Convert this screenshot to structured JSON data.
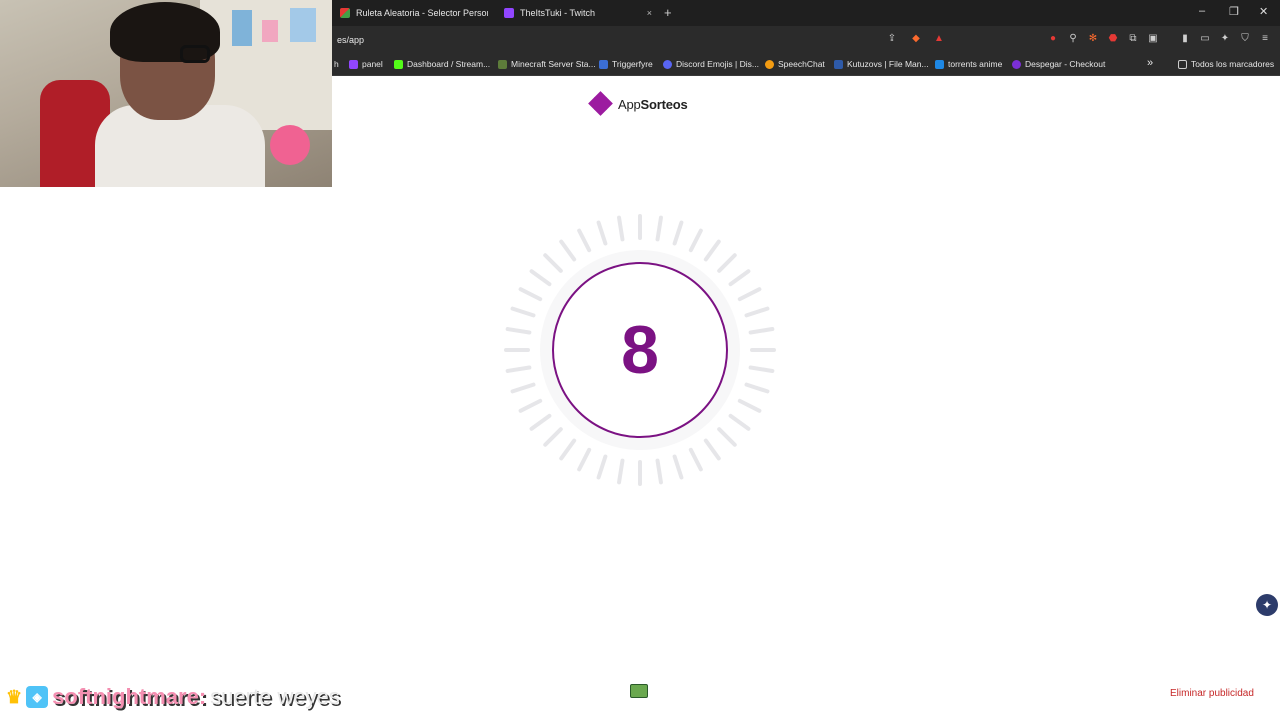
{
  "tabs": [
    {
      "title": "Ruleta Aleatoria - Selector Personaliz",
      "active": true
    },
    {
      "title": "TheItsTuki - Twitch",
      "close": "×"
    }
  ],
  "new_tab": "+",
  "window_controls": {
    "minimize": "–",
    "restore": "❐",
    "close": "✕"
  },
  "address_bar": {
    "url": "es/app"
  },
  "bookmarks": [
    {
      "label": "h"
    },
    {
      "label": "panel"
    },
    {
      "label": "Dashboard / Stream..."
    },
    {
      "label": "Minecraft Server Sta..."
    },
    {
      "label": "Triggerfyre"
    },
    {
      "label": "Discord Emojis | Dis..."
    },
    {
      "label": "SpeechChat"
    },
    {
      "label": "Kutuzovs | File Man..."
    },
    {
      "label": "torrents anime"
    },
    {
      "label": "Despegar - Checkout"
    },
    {
      "label": "»"
    },
    {
      "label": "Todos los marcadores"
    }
  ],
  "app": {
    "logo_prefix": "App",
    "logo_bold": "Sorteos",
    "countdown": "8",
    "remove_ads": "Eliminar publicidad"
  },
  "chat_overlay": {
    "username": "softnightmare:",
    "message": "suerte weyes"
  },
  "colors": {
    "brand": "#7b1283",
    "remove_ads": "#c62828"
  }
}
